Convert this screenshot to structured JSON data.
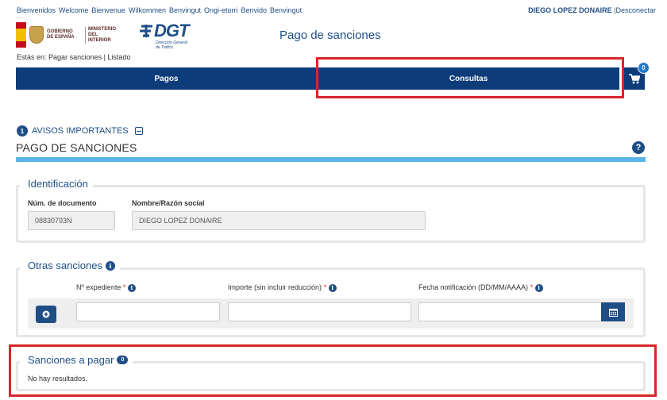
{
  "header": {
    "languages": [
      "Bienvenidos",
      "Welcome",
      "Bienvenue",
      "Wilkommen",
      "Benvingut",
      "Ongi-etorri",
      "Benvido",
      "Benvingut"
    ],
    "user_name": "DIEGO LOPEZ DONAIRE",
    "logout_label": "Desconectar",
    "gov_line1": "GOBIERNO",
    "gov_line2": "DE ESPAÑA",
    "ministry_line1": "MINISTERIO",
    "ministry_line2": "DEL INTERIOR",
    "dgt_logo": "DGT",
    "dgt_sub1": "Dirección General",
    "dgt_sub2": "de Tráfico",
    "page_title": "Pago de sanciones"
  },
  "breadcrumb": {
    "prefix": "Estás en:",
    "path": "Pagar sanciones | Listado"
  },
  "nav": {
    "items": [
      {
        "label": "Pagos"
      },
      {
        "label": "Consultas"
      }
    ],
    "cart_count": "0"
  },
  "avisos": {
    "count": "1",
    "label": "AVISOS IMPORTANTES"
  },
  "section": {
    "title": "PAGO DE SANCIONES",
    "help_label": "?"
  },
  "identificacion": {
    "legend": "Identificación",
    "doc_label": "Núm. de documento",
    "doc_value": "08830793N",
    "name_label": "Nombre/Razón social",
    "name_value": "DIEGO LOPEZ  DONAIRE"
  },
  "otras": {
    "legend": "Otras sanciones",
    "expediente_label": "Nº expediente",
    "importe_label": "Importe (sin incluir reducción)",
    "fecha_label": "Fecha notificación (DD/MM/AAAA)",
    "required_mark": "*"
  },
  "sanciones": {
    "legend": "Sanciones a pagar",
    "count": "0",
    "empty_text": "No hay resultados."
  },
  "colors": {
    "primary": "#0d3c7a",
    "accent": "#5ab4e6",
    "highlight": "#d9262b"
  }
}
